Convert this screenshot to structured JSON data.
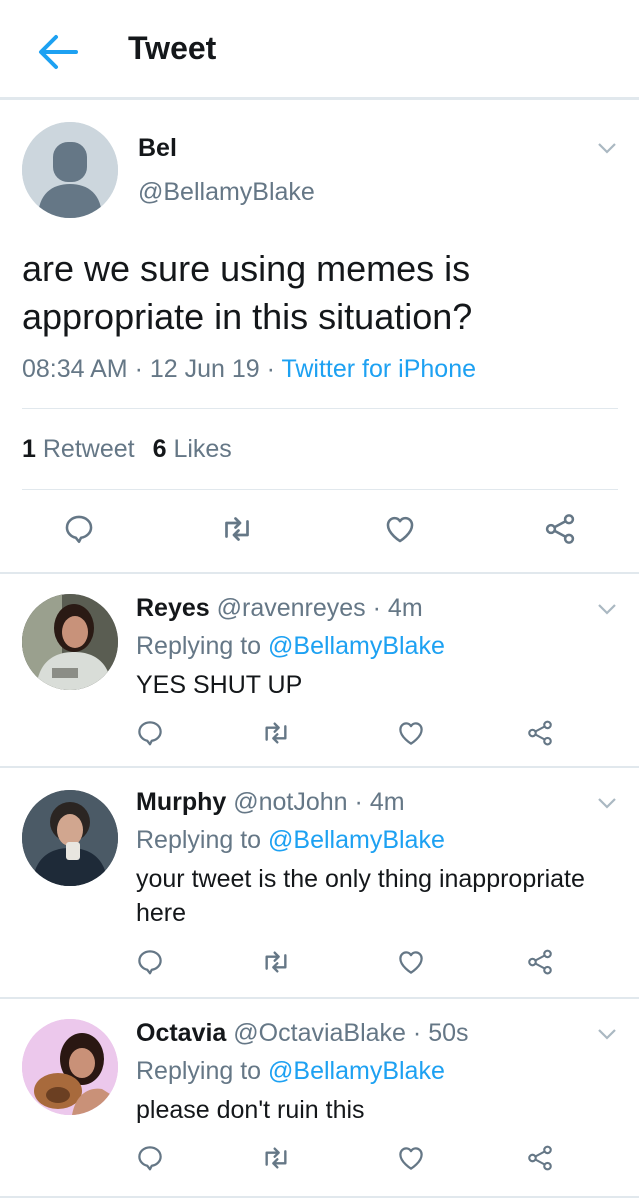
{
  "header": {
    "title": "Tweet",
    "back_icon": "arrow-left-icon",
    "accent": "#1da1f2"
  },
  "tweet": {
    "author_name": "Bel",
    "author_handle": "@BellamyBlake",
    "text": "are we sure using memes is appropriate in this situation?",
    "time": "08:34 AM",
    "sep1": "·",
    "date": "12 Jun 19",
    "sep2": "·",
    "source": "Twitter for iPhone",
    "retweet_count": "1",
    "retweet_label": "Retweet",
    "like_count": "6",
    "like_label": "Likes"
  },
  "replies": [
    {
      "name": "Reyes",
      "handle": "@ravenreyes",
      "dot": "·",
      "time": "4m",
      "replying_prefix": "Replying to",
      "replying_to": "@BellamyBlake",
      "text": "YES SHUT UP"
    },
    {
      "name": "Murphy",
      "handle": "@notJohn",
      "dot": "·",
      "time": "4m",
      "replying_prefix": "Replying to",
      "replying_to": "@BellamyBlake",
      "text": "your tweet is the only thing inappropriate here"
    },
    {
      "name": "Octavia",
      "handle": "@OctaviaBlake",
      "dot": "·",
      "time": "50s",
      "replying_prefix": "Replying to",
      "replying_to": "@BellamyBlake",
      "text": "please don't ruin this"
    }
  ],
  "colors": {
    "text": "#14171a",
    "secondary": "#657786",
    "link": "#1da1f2",
    "border": "#e1e8ed",
    "icon": "#657786"
  }
}
